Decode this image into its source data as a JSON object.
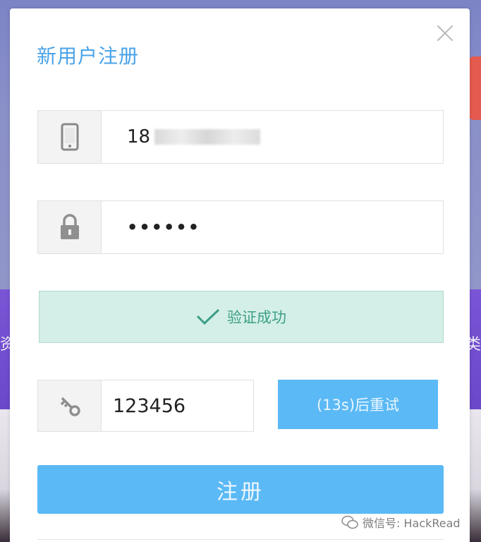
{
  "background": {
    "left_char": "资",
    "right_char": "类"
  },
  "modal": {
    "title": "新用户注册",
    "phone": {
      "value_prefix": "18"
    },
    "password": {
      "masked_value": "••••••"
    },
    "verify": {
      "text": "验证成功"
    },
    "code": {
      "value": "123456"
    },
    "resend_button": "(13s)后重试",
    "register_button": "注册"
  },
  "watermark": {
    "text": "微信号: HackRead"
  },
  "colors": {
    "title": "#4aa3e8",
    "primary_button": "#5bb9f5",
    "success_bg": "#d4efe8",
    "success_text": "#3d9f85"
  },
  "icons": {
    "close": "close-icon",
    "phone": "phone-icon",
    "lock": "lock-icon",
    "key": "key-icon",
    "check": "check-icon"
  }
}
